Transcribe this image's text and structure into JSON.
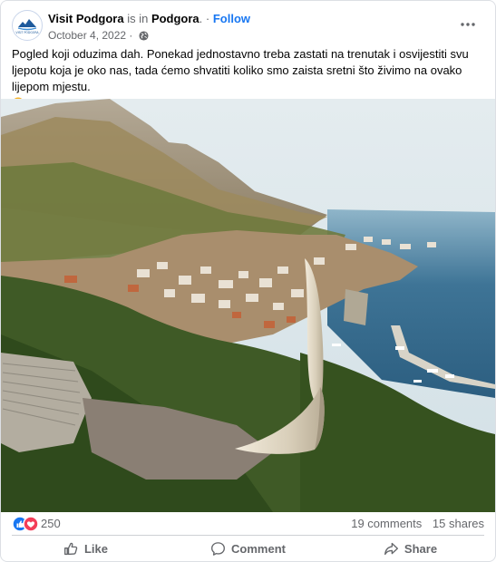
{
  "post": {
    "page_name": "Visit Podgora",
    "is_in": "is in",
    "place": "Podgora",
    "separator": ". ·",
    "follow_label": "Follow",
    "date": "October 4, 2022",
    "date_sep": "·",
    "caption": "Pogled koji oduzima dah. Ponekad jednostavno treba zastati na trenutak i osvijestiti svu ljepotu koja je oko nas, tada ćemo shvatiti koliko smo zaista sretni što živimo na ovako lijepom mjestu.",
    "caption_emoji": "heart-eyes-emoji",
    "privacy_icon": "globe-icon",
    "more_icon": "more-horizontal-icon"
  },
  "avatar": {
    "logo_text": "VISIT PODGORA"
  },
  "reactions": {
    "icons": [
      "like-reaction-icon",
      "love-reaction-icon"
    ],
    "count": "250",
    "comments": "19 comments",
    "shares": "15 shares"
  },
  "actions": [
    {
      "label": "Like",
      "icon": "thumbs-up-icon"
    },
    {
      "label": "Comment",
      "icon": "comment-icon"
    },
    {
      "label": "Share",
      "icon": "share-icon"
    }
  ],
  "colors": {
    "accent": "#1877f2",
    "muted_text": "#65676b",
    "like_blue": "#1877f2",
    "love_red": "#f33e58",
    "divider": "#ced0d4"
  }
}
